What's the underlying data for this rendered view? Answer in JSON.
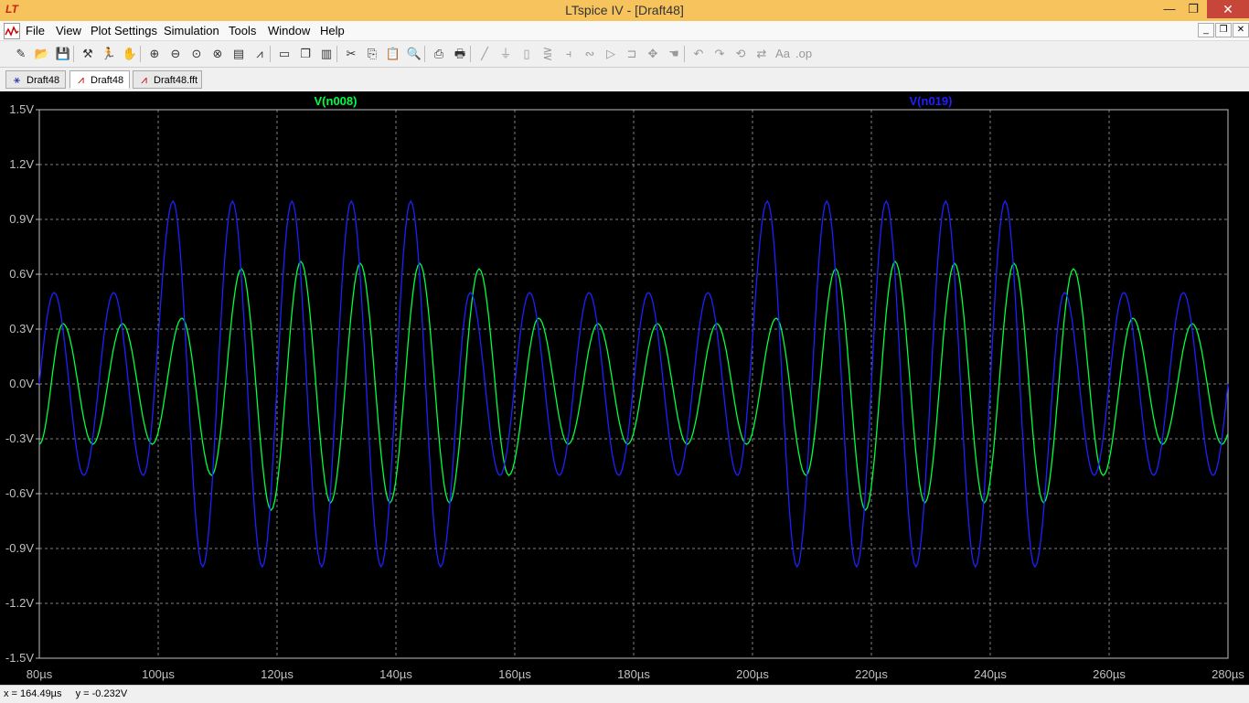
{
  "window": {
    "title": "LTspice IV - [Draft48]",
    "minimize": "—",
    "maximize": "❐",
    "close": "✕"
  },
  "menubar": [
    "File",
    "View",
    "Plot Settings",
    "Simulation",
    "Tools",
    "Window",
    "Help"
  ],
  "mdi_buttons": [
    "_",
    "❐",
    "✕"
  ],
  "toolbar_icons": [
    "new-schematic-icon",
    "open-icon",
    "save-icon",
    "control-panel-icon",
    "run-icon",
    "halt-icon",
    "zoom-in-icon",
    "zoom-out-icon",
    "zoom-fit-icon",
    "zoom-cancel-icon",
    "autorange-icon",
    "add-trace-icon",
    "tile-horizontal-icon",
    "cascade-icon",
    "tile-vertical-icon",
    "cut-icon",
    "copy-icon",
    "paste-icon",
    "find-icon",
    "print-preview-icon",
    "print-icon",
    "wire-icon",
    "ground-icon",
    "label-icon",
    "resistor-icon",
    "capacitor-icon",
    "inductor-icon",
    "diode-icon",
    "component-icon",
    "move-icon",
    "drag-icon",
    "undo-icon",
    "redo-icon",
    "rotate-icon",
    "mirror-icon",
    "text-icon",
    "spice-directive-icon"
  ],
  "tabs": [
    {
      "label": "Draft48",
      "icon": "schematic-icon",
      "active": false
    },
    {
      "label": "Draft48",
      "icon": "waveform-icon",
      "active": true
    },
    {
      "label": "Draft48.fft",
      "icon": "waveform-icon",
      "active": false
    }
  ],
  "status": {
    "x": "x = 164.49µs",
    "y": "y = -0.232V"
  },
  "chart_data": {
    "type": "line",
    "x_unit": "µs",
    "xlim": [
      80,
      280
    ],
    "ylim": [
      -1.5,
      1.5
    ],
    "x_ticks": [
      "80µs",
      "100µs",
      "120µs",
      "140µs",
      "160µs",
      "180µs",
      "200µs",
      "220µs",
      "240µs",
      "260µs",
      "280µs"
    ],
    "y_ticks": [
      "1.5V",
      "1.2V",
      "0.9V",
      "0.6V",
      "0.3V",
      "0.0V",
      "-0.3V",
      "-0.6V",
      "-0.9V",
      "-1.2V",
      "-1.5V"
    ],
    "grid": true,
    "background": "#000000",
    "series": [
      {
        "name": "V(n008)",
        "color": "#00ff40",
        "period_us": 10.0,
        "peaks": [
          [
            84.0,
            0.33
          ],
          [
            94.0,
            0.33
          ],
          [
            104.0,
            0.36
          ],
          [
            114.0,
            0.63
          ],
          [
            124.0,
            0.67
          ],
          [
            134.0,
            0.66
          ],
          [
            144.0,
            0.66
          ],
          [
            154.0,
            0.63
          ],
          [
            164.0,
            0.36
          ],
          [
            174.0,
            0.33
          ],
          [
            184.0,
            0.33
          ],
          [
            194.0,
            0.33
          ],
          [
            204.0,
            0.36
          ],
          [
            214.0,
            0.63
          ],
          [
            224.0,
            0.67
          ],
          [
            234.0,
            0.66
          ],
          [
            244.0,
            0.66
          ],
          [
            254.0,
            0.63
          ],
          [
            264.0,
            0.36
          ],
          [
            274.0,
            0.33
          ]
        ],
        "troughs": [
          [
            80.0,
            -0.33
          ],
          [
            89.0,
            -0.33
          ],
          [
            99.0,
            -0.33
          ],
          [
            109.0,
            -0.5
          ],
          [
            119.0,
            -0.69
          ],
          [
            129.0,
            -0.65
          ],
          [
            139.0,
            -0.65
          ],
          [
            149.0,
            -0.65
          ],
          [
            159.0,
            -0.5
          ],
          [
            169.0,
            -0.33
          ],
          [
            179.0,
            -0.33
          ],
          [
            189.0,
            -0.33
          ],
          [
            199.0,
            -0.33
          ],
          [
            209.0,
            -0.5
          ],
          [
            219.0,
            -0.69
          ],
          [
            229.0,
            -0.65
          ],
          [
            239.0,
            -0.65
          ],
          [
            249.0,
            -0.65
          ],
          [
            259.0,
            -0.5
          ],
          [
            269.0,
            -0.33
          ],
          [
            279.0,
            -0.33
          ]
        ]
      },
      {
        "name": "V(n019)",
        "color": "#2020ff",
        "period_us": 10.0,
        "peaks": [
          [
            82.5,
            0.5
          ],
          [
            92.5,
            0.5
          ],
          [
            102.5,
            1.0
          ],
          [
            112.5,
            1.0
          ],
          [
            122.5,
            1.0
          ],
          [
            132.5,
            1.0
          ],
          [
            142.5,
            1.0
          ],
          [
            152.5,
            0.5
          ],
          [
            162.5,
            0.5
          ],
          [
            172.5,
            0.5
          ],
          [
            182.5,
            0.5
          ],
          [
            192.5,
            0.5
          ],
          [
            202.5,
            1.0
          ],
          [
            212.5,
            1.0
          ],
          [
            222.5,
            1.0
          ],
          [
            232.5,
            1.0
          ],
          [
            242.5,
            1.0
          ],
          [
            252.5,
            0.5
          ],
          [
            262.5,
            0.5
          ],
          [
            272.5,
            0.5
          ]
        ],
        "troughs": [
          [
            87.5,
            -0.5
          ],
          [
            97.5,
            -0.5
          ],
          [
            107.5,
            -1.0
          ],
          [
            117.5,
            -1.0
          ],
          [
            127.5,
            -1.0
          ],
          [
            137.5,
            -1.0
          ],
          [
            147.5,
            -1.0
          ],
          [
            157.5,
            -0.5
          ],
          [
            167.5,
            -0.5
          ],
          [
            177.5,
            -0.5
          ],
          [
            187.5,
            -0.5
          ],
          [
            197.5,
            -0.5
          ],
          [
            207.5,
            -1.0
          ],
          [
            217.5,
            -1.0
          ],
          [
            227.5,
            -1.0
          ],
          [
            237.5,
            -1.0
          ],
          [
            247.5,
            -1.0
          ],
          [
            257.5,
            -0.5
          ],
          [
            267.5,
            -0.5
          ],
          [
            277.5,
            -0.5
          ]
        ]
      }
    ]
  }
}
